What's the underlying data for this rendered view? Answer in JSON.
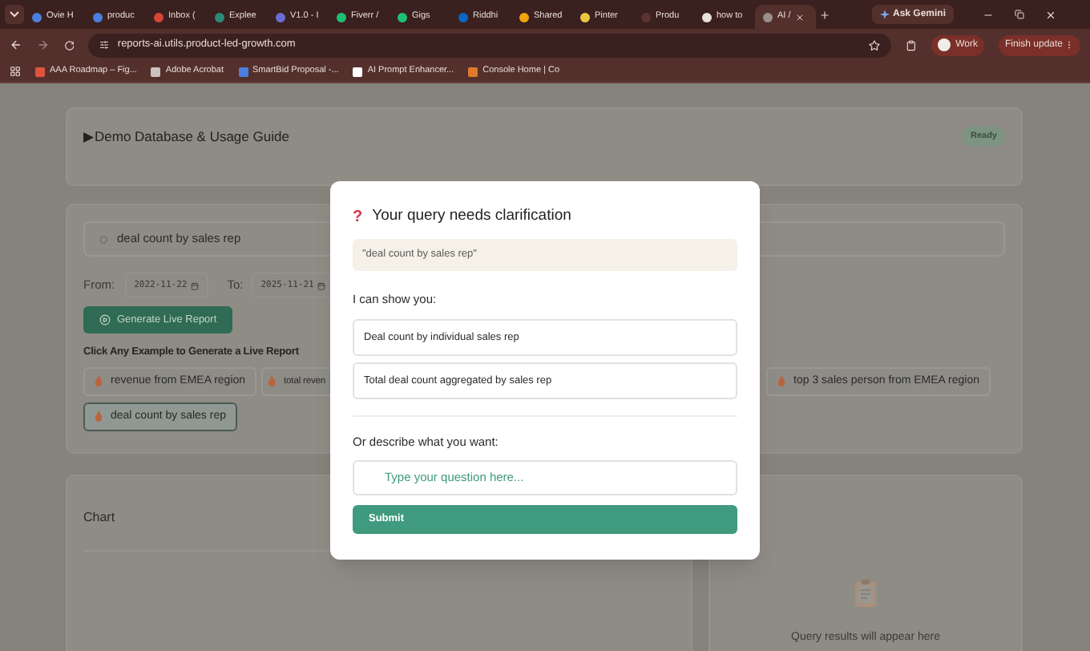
{
  "browser": {
    "tabs": [
      {
        "title": "Ovie H",
        "selected": false,
        "color": "#4a7fe0"
      },
      {
        "title": "produc",
        "selected": false,
        "color": "#4a7fe0"
      },
      {
        "title": "Inbox (",
        "selected": false,
        "color": "#d44638"
      },
      {
        "title": "Explee",
        "selected": false,
        "color": "#2c8a7a"
      },
      {
        "title": "V1.0 - I",
        "selected": false,
        "color": "#6b6bd6"
      },
      {
        "title": "Fiverr /",
        "selected": false,
        "color": "#1dbf73"
      },
      {
        "title": "Gigs",
        "selected": false,
        "color": "#1dbf73"
      },
      {
        "title": "Riddhi",
        "selected": false,
        "color": "#0a66c2"
      },
      {
        "title": "Shared",
        "selected": false,
        "color": "#f0a30a"
      },
      {
        "title": "Pinter",
        "selected": false,
        "color": "#e8c840"
      },
      {
        "title": "Produ",
        "selected": false,
        "color": "#5a3430"
      },
      {
        "title": "how to",
        "selected": false,
        "color": "#e8e2d8"
      },
      {
        "title": "AI /",
        "selected": true,
        "color": "#9a8f8a"
      }
    ],
    "gemini": "Ask Gemini",
    "url": "reports-ai.utils.product-led-growth.com",
    "profile": "Work",
    "update": "Finish update",
    "bookmarks": [
      {
        "title": "AAA Roadmap – Fig...",
        "color": "#e0533d"
      },
      {
        "title": "Adobe Acrobat",
        "color": "#c9c2bf"
      },
      {
        "title": "SmartBid Proposal -...",
        "color": "#4a7fe0"
      },
      {
        "title": "AI Prompt Enhancer...",
        "color": "#ffffff"
      },
      {
        "title": "Console Home | Co",
        "color": "#e07a2a"
      }
    ]
  },
  "guide": {
    "title": "▶Demo Database & Usage Guide",
    "status": "Ready"
  },
  "query": {
    "value": "deal count by sales rep",
    "from_label": "From:",
    "from": "2022-11-22",
    "to_label": "To:",
    "to": "2025-11-21",
    "generate": "Generate Live Report",
    "examples_title": "Click Any Example to Generate a Live Report",
    "examples": [
      {
        "label": "revenue from EMEA region",
        "selected": false
      },
      {
        "label": "total reven",
        "selected": false
      },
      {
        "label": "top 3 sales person from EMEA region",
        "selected": false
      },
      {
        "label": "deal count by sales rep",
        "selected": true
      }
    ]
  },
  "chart": {
    "title": "Chart"
  },
  "results": {
    "empty": "Query results will appear here"
  },
  "dialog": {
    "icon": "?",
    "title": "Your query needs clarification",
    "query": "\"deal count by sales rep\"",
    "options_label": "I can show you:",
    "options": [
      "Deal count by individual sales rep",
      "Total deal count aggregated by sales rep"
    ],
    "describe_label": "Or describe what you want:",
    "placeholder": "Type your question here...",
    "submit": "Submit"
  }
}
